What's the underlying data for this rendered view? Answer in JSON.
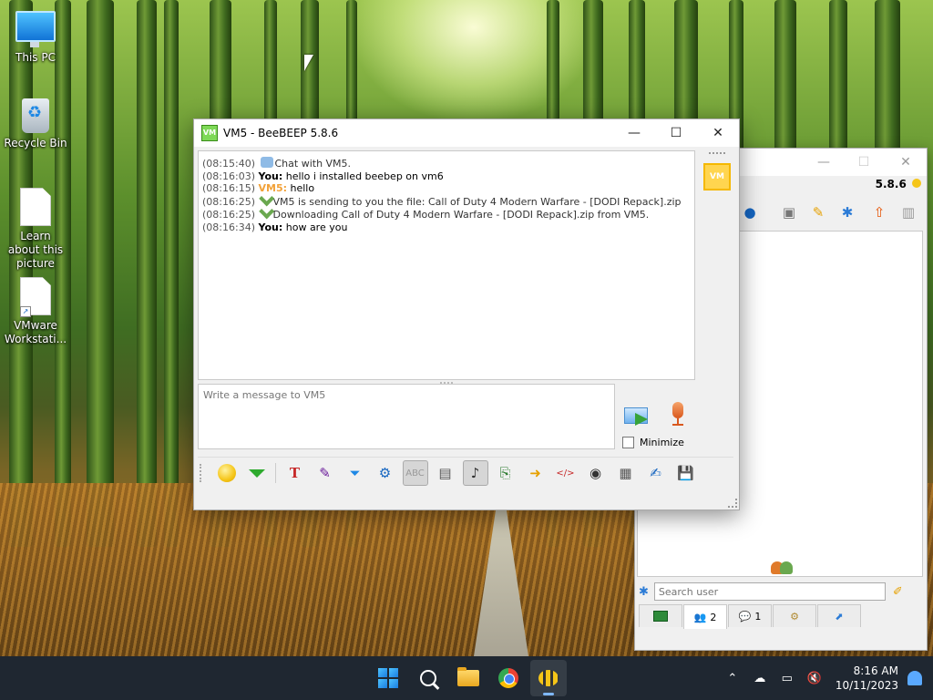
{
  "desktop": {
    "icons": [
      {
        "label": "This PC"
      },
      {
        "label": "Recycle Bin"
      },
      {
        "label": "Learn about this picture"
      },
      {
        "label": "VMware Workstati..."
      }
    ]
  },
  "chat_window": {
    "title": "VM5 - BeeBEEP 5.8.6",
    "app_icon_text": "VM",
    "messages": [
      {
        "time": "(08:15:40)",
        "sender": "",
        "text": "Chat with VM5.",
        "kind": "system",
        "icon": "chat-bubble-icon"
      },
      {
        "time": "(08:16:03)",
        "sender": "You:",
        "text": "hello i installed beebep on vm6",
        "kind": "you"
      },
      {
        "time": "(08:16:15)",
        "sender": "VM5:",
        "text": "hello",
        "kind": "peer"
      },
      {
        "time": "(08:16:25)",
        "sender": "",
        "text": "VM5 is sending to you the file: Call of Duty 4 Modern Warfare - [DODI Repack].zip",
        "kind": "system",
        "icon": "file-transfer-icon"
      },
      {
        "time": "(08:16:25)",
        "sender": "",
        "text": "Downloading Call of Duty 4 Modern Warfare - [DODI Repack].zip from VM5.",
        "kind": "system",
        "icon": "file-transfer-icon"
      },
      {
        "time": "(08:16:34)",
        "sender": "You:",
        "text": "how are you",
        "kind": "you"
      }
    ],
    "compose_placeholder": "Write a message to VM5",
    "minimize_label": "Minimize",
    "minimize_checked": false,
    "avatar_text": "VM"
  },
  "main_window": {
    "version": "5.8.6",
    "search_placeholder": "Search user",
    "tabs": [
      {
        "count": ""
      },
      {
        "count": "2"
      },
      {
        "count": "1"
      },
      {
        "count": ""
      },
      {
        "count": ""
      }
    ]
  },
  "taskbar": {
    "time": "8:16 AM",
    "date": "10/11/2023"
  },
  "colors": {
    "peer_name": "#f2a23a",
    "taskbar_bg": "#1f2731",
    "accent": "#4ec4ff"
  }
}
